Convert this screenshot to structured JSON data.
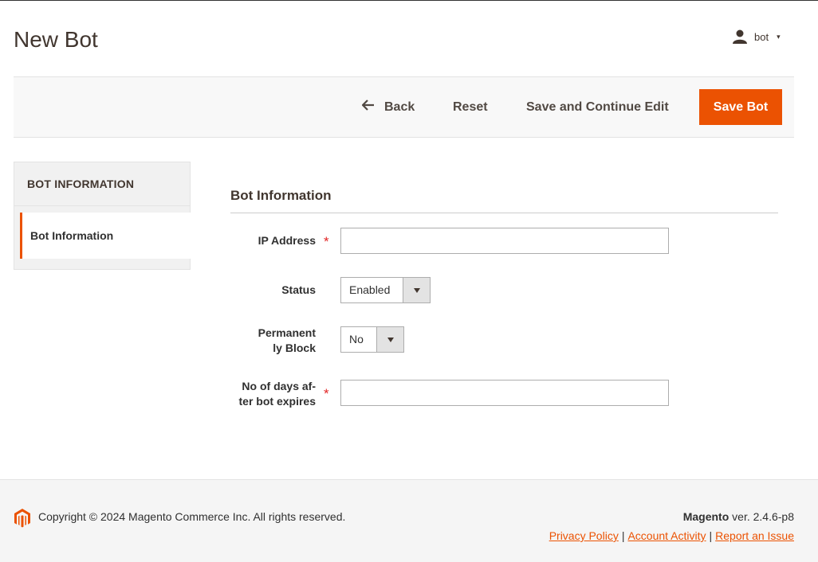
{
  "page": {
    "title": "New Bot"
  },
  "user": {
    "name": "bot",
    "icon": "user-icon",
    "caret": "▾"
  },
  "actions": {
    "back": "Back",
    "reset": "Reset",
    "save_continue": "Save and Continue Edit",
    "save": "Save Bot",
    "accent_color": "#eb5202"
  },
  "sidebar": {
    "title": "BOT INFORMATION",
    "items": [
      {
        "label": "Bot Information"
      }
    ]
  },
  "form": {
    "section_title": "Bot Information",
    "required_mark": "*",
    "fields": {
      "ip_address": {
        "label": "IP Address",
        "value": ""
      },
      "status": {
        "label": "Status",
        "value": "Enabled"
      },
      "permanently_block": {
        "label_line1": "Permanent",
        "label_line2": "ly Block",
        "value": "No"
      },
      "days_expire": {
        "label_line1": "No of days af-",
        "label_line2": "ter bot expires",
        "value": ""
      }
    }
  },
  "footer": {
    "copyright": "Copyright © 2024 Magento Commerce Inc. All rights reserved.",
    "brand": "Magento",
    "version": " ver. 2.4.6-p8",
    "links": [
      "Privacy Policy",
      "Account Activity",
      "Report an Issue"
    ],
    "separator": "|"
  }
}
